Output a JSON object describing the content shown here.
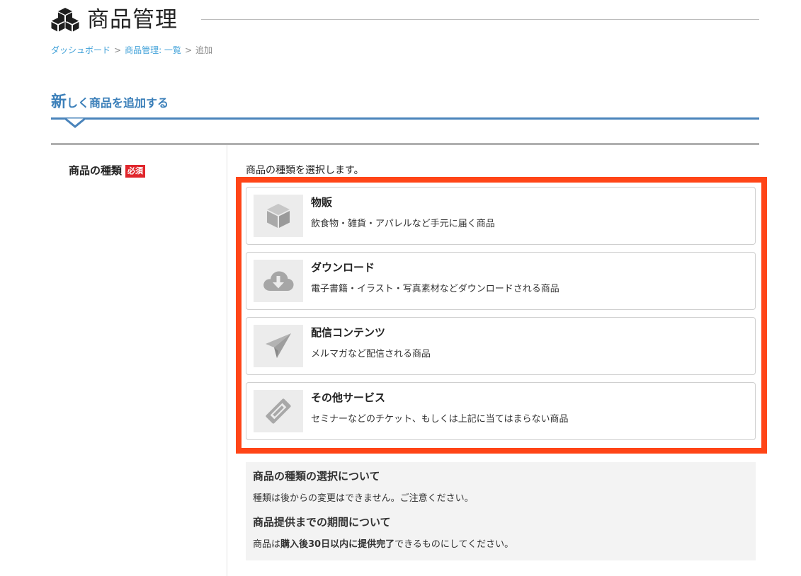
{
  "header": {
    "title": "商品管理"
  },
  "breadcrumb": [
    {
      "label": "ダッシュボード"
    },
    {
      "label": "商品管理: 一覧"
    },
    {
      "label": "追加"
    }
  ],
  "breadcrumb_separator": ">",
  "section": {
    "title_first": "新",
    "title_rest": "しく商品を追加する"
  },
  "field": {
    "label": "商品の種類",
    "required_badge": "必須",
    "description": "商品の種類を選択します。"
  },
  "options": [
    {
      "title": "物販",
      "description": "飲食物・雑貨・アパレルなど手元に届く商品",
      "icon": "box-icon"
    },
    {
      "title": "ダウンロード",
      "description": "電子書籍・イラスト・写真素材などダウンロードされる商品",
      "icon": "cloud-download-icon"
    },
    {
      "title": "配信コンテンツ",
      "description": "メルマガなど配信される商品",
      "icon": "paper-plane-icon"
    },
    {
      "title": "その他サービス",
      "description": "セミナーなどのチケット、もしくは上記に当てはまらない商品",
      "icon": "ticket-icon"
    }
  ],
  "info": {
    "heading1": "商品の種類の選択について",
    "text1": "種類は後からの変更はできません。ご注意ください。",
    "heading2": "商品提供までの期間について",
    "text2_before": "商品は",
    "text2_bold": "購入後30日以内に提供完了",
    "text2_after": "できるものにしてください。"
  },
  "colors": {
    "accent_blue": "#3b7fb9",
    "link_blue": "#3ea0d8",
    "highlight_red": "#ff4517",
    "required_red": "#e0262c"
  }
}
